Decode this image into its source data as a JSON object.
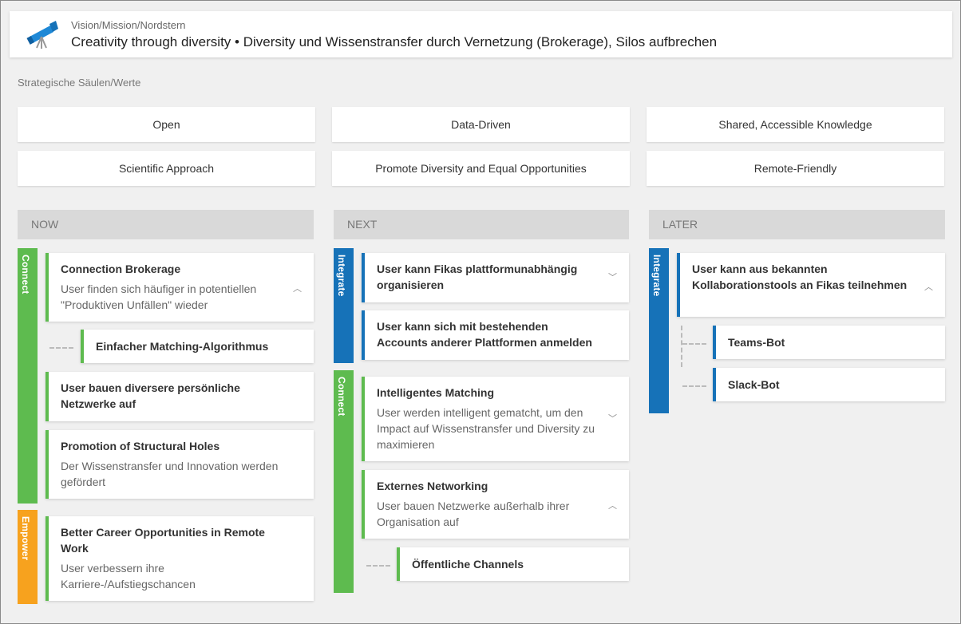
{
  "header": {
    "kicker": "Vision/Mission/Nordstern",
    "title": "Creativity through diversity • Diversity und Wissenstransfer durch Vernetzung (Brokerage), Silos aufbrechen",
    "icon": "telescope-icon"
  },
  "pillars_label": "Strategische Säulen/Werte",
  "pillars": [
    "Open",
    "Data-Driven",
    "Shared, Accessible Knowledge",
    "Scientific Approach",
    "Promote Diversity and Equal Opportunities",
    "Remote-Friendly"
  ],
  "columns": {
    "now": {
      "label": "NOW",
      "lanes": {
        "connect": "Connect",
        "empower": "Empower"
      },
      "cards": [
        {
          "title": "Connection Brokerage",
          "desc": "User finden sich häufiger in potentiellen \"Produktiven Unfällen\" wieder",
          "expanded": true
        },
        {
          "title": "Einfacher Matching-Algorithmus"
        },
        {
          "title": "User bauen diversere persönliche Netzwerke auf"
        },
        {
          "title": "Promotion of Structural Holes",
          "desc": "Der Wissenstransfer und Innovation werden gefördert"
        },
        {
          "title": "Better Career Opportunities in Remote Work",
          "desc": "User verbessern ihre Karriere-/Aufstiegschancen"
        }
      ]
    },
    "next": {
      "label": "NEXT",
      "lanes": {
        "integrate": "Integrate",
        "connect": "Connect"
      },
      "cards": [
        {
          "title": "User kann Fikas plattformunabhängig organisieren",
          "expanded": false
        },
        {
          "title": "User kann sich mit bestehenden Accounts anderer Plattformen anmelden"
        },
        {
          "title": "Intelligentes Matching",
          "desc": "User werden intelligent gematcht, um den Impact auf Wissenstransfer und Diversity zu maximieren",
          "expanded": false
        },
        {
          "title": "Externes Networking",
          "desc": "User bauen Netzwerke außerhalb ihrer Organisation auf",
          "expanded": true
        },
        {
          "title": "Öffentliche Channels"
        }
      ]
    },
    "later": {
      "label": "LATER",
      "lanes": {
        "integrate": "Integrate"
      },
      "cards": [
        {
          "title": "User kann aus bekannten Kollaborationstools an Fikas teilnehmen",
          "expanded": true
        },
        {
          "title": "Teams-Bot"
        },
        {
          "title": "Slack-Bot"
        }
      ]
    }
  },
  "colors": {
    "connect": "#5ebb4f",
    "integrate": "#1672b8",
    "empower": "#f7a21e"
  }
}
